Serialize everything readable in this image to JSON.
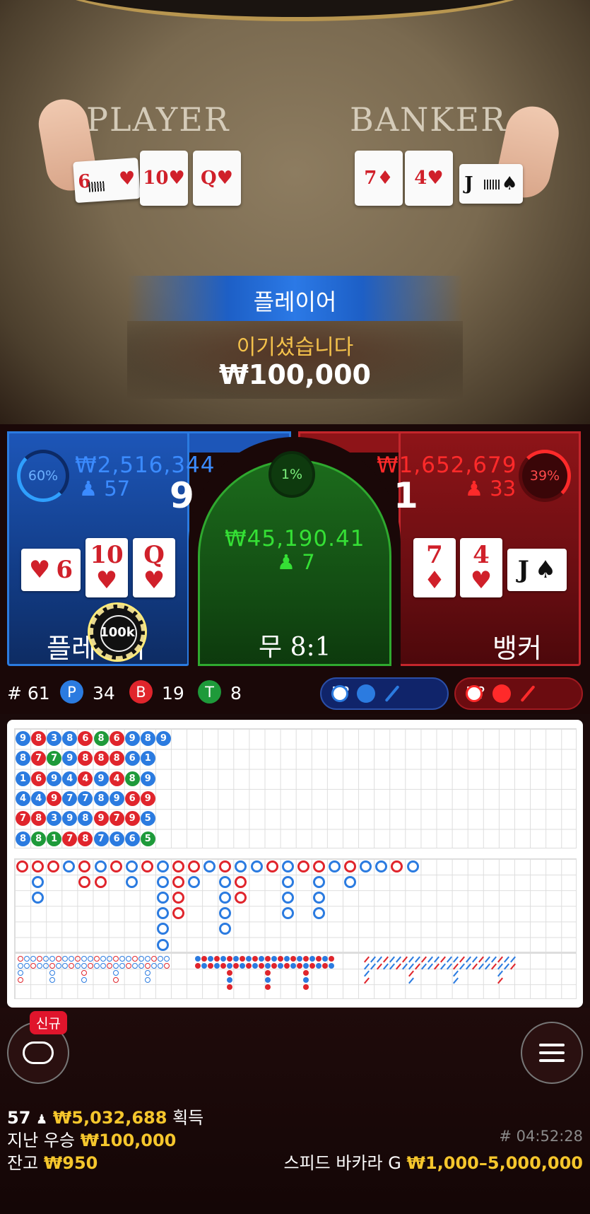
{
  "table": {
    "player_word": "PLAYER",
    "banker_word": "BANKER",
    "player_cards": [
      {
        "v": "6",
        "s": "♥",
        "flip": true
      },
      {
        "v": "10",
        "s": "♥"
      },
      {
        "v": "Q",
        "s": "♥"
      }
    ],
    "banker_cards": [
      {
        "v": "7",
        "s": "♦"
      },
      {
        "v": "4",
        "s": "♥"
      },
      {
        "v": "J",
        "s": "♠",
        "black": true
      }
    ]
  },
  "result": {
    "side": "플레이어",
    "message": "이기셨습니다",
    "amount": "₩100,000"
  },
  "player_spot": {
    "percent": "60%",
    "percent_value": 0.6,
    "total": "₩2,516,344",
    "players": "57",
    "score": "9",
    "label": "플레이어",
    "cards": [
      {
        "v": "6",
        "s": "♥",
        "horizontal": true
      },
      {
        "v": "10",
        "s": "♥"
      },
      {
        "v": "Q",
        "s": "♥"
      }
    ],
    "chip": "100k"
  },
  "tie_spot": {
    "percent": "1%",
    "percent_value": 0.01,
    "total": "₩45,190.41",
    "players": "7",
    "label": "무 8:1"
  },
  "banker_spot": {
    "percent": "39%",
    "percent_value": 0.39,
    "total": "₩1,652,679",
    "players": "33",
    "score": "1",
    "label": "뱅커",
    "cards": [
      {
        "v": "7",
        "s": "♦"
      },
      {
        "v": "4",
        "s": "♥"
      },
      {
        "v": "J",
        "s": "♠",
        "horizontal": true,
        "black": true
      }
    ]
  },
  "stats": {
    "round": "# 61",
    "p_letter": "P",
    "p_count": "34",
    "b_letter": "B",
    "b_count": "19",
    "t_letter": "T",
    "t_count": "8",
    "player_predict": "P?",
    "banker_predict": "B?"
  },
  "bead_road": [
    [
      "B",
      "R",
      "B",
      "B",
      "R",
      "G",
      "R",
      "B",
      "B",
      "B"
    ],
    [
      "B",
      "R",
      "G",
      "B",
      "R",
      "R",
      "R",
      "B",
      "B",
      "G"
    ],
    [
      "B",
      "R",
      "B",
      "B",
      "R",
      "B",
      "R",
      "G",
      "B",
      "R"
    ],
    [
      "B",
      "B",
      "R",
      "B",
      "B",
      "B",
      "B",
      "R",
      "R",
      "B"
    ],
    [
      "R",
      "R",
      "B",
      "B",
      "B",
      "R",
      "R",
      "R",
      "B",
      "R"
    ],
    [
      "B",
      "G",
      "G",
      "R",
      "R",
      "B",
      "B",
      "B",
      "G",
      "G"
    ]
  ],
  "bead_values": [
    [
      "9",
      "8",
      "3",
      "8",
      "6",
      "8",
      "6",
      "9",
      "8",
      "9"
    ],
    [
      "8",
      "7",
      "7",
      "9",
      "8",
      "8",
      "8",
      "6",
      "1",
      ""
    ],
    [
      "1",
      "6",
      "9",
      "4",
      "4",
      "9",
      "4",
      "8",
      "9",
      ""
    ],
    [
      "4",
      "4",
      "9",
      "7",
      "7",
      "8",
      "9",
      "6",
      "9",
      ""
    ],
    [
      "7",
      "8",
      "3",
      "9",
      "8",
      "9",
      "7",
      "9",
      "5",
      ""
    ],
    [
      "8",
      "8",
      "1",
      "7",
      "8",
      "7",
      "6",
      "6",
      "5",
      ""
    ]
  ],
  "colors": {
    "player_blue": "#2b7be0",
    "banker_red": "#e0252c",
    "tie_green": "#1e9a3a",
    "gold": "#f5c62c"
  },
  "bottom": {
    "new_badge": "신규",
    "online_count": "57",
    "won_total": "₩5,032,688",
    "won_label": "획득",
    "last_win_label": "지난 우승",
    "last_win": "₩100,000",
    "balance_label": "잔고",
    "balance": "₩950",
    "game_id": "# 04:52:28",
    "table_name": "스피드 바카라 G",
    "limits": "₩1,000–5,000,000"
  },
  "icons": [
    "chat-icon",
    "menu-icon",
    "user-icon"
  ]
}
